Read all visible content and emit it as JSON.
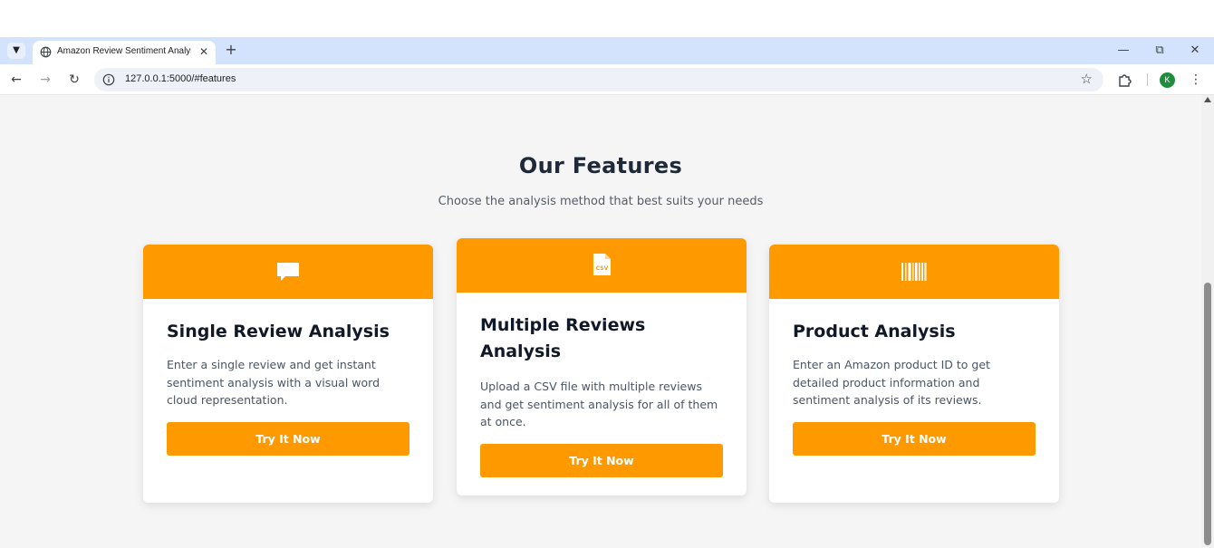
{
  "browser": {
    "tab_title": "Amazon Review Sentiment Analysis",
    "url": "127.0.0.1:5000/#features",
    "profile_initial": "K"
  },
  "features": {
    "title": "Our Features",
    "subtitle": "Choose the analysis method that best suits your needs",
    "cards": [
      {
        "icon": "comment-icon",
        "title": "Single Review Analysis",
        "description": "Enter a single review and get instant sentiment analysis with a visual word cloud representation.",
        "button": "Try It Now"
      },
      {
        "icon": "csv-file-icon",
        "title": "Multiple Reviews Analysis",
        "description": "Upload a CSV file with multiple reviews and get sentiment analysis for all of them at once.",
        "button": "Try It Now"
      },
      {
        "icon": "barcode-icon",
        "title": "Product Analysis",
        "description": "Enter an Amazon product ID to get detailed product information and sentiment analysis of its reviews.",
        "button": "Try It Now"
      }
    ]
  },
  "colors": {
    "accent": "#ff9900",
    "tabstrip": "#d3e3fd",
    "page_bg": "#f5f5f5",
    "heading": "#1f2937"
  }
}
